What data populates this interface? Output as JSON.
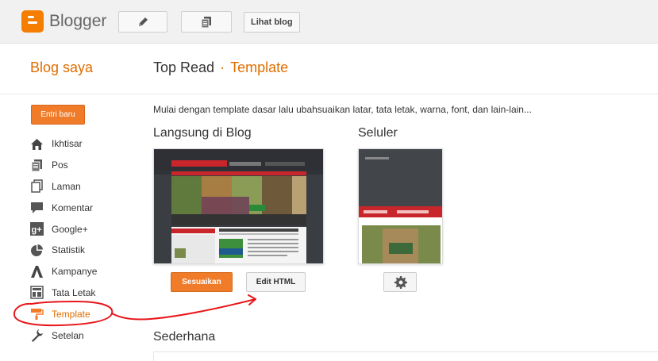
{
  "topbar": {
    "brand": "Blogger",
    "view_blog_label": "Lihat blog",
    "icons": [
      "pencil-icon",
      "posts-icon"
    ]
  },
  "header": {
    "left_title": "Blog saya",
    "blog_name": "Top Read",
    "separator": "·",
    "page": "Template"
  },
  "sidebar": {
    "new_post_label": "Entri baru",
    "items": [
      {
        "label": "Ikhtisar",
        "icon": "home-icon"
      },
      {
        "label": "Pos",
        "icon": "posts-icon"
      },
      {
        "label": "Laman",
        "icon": "pages-icon"
      },
      {
        "label": "Komentar",
        "icon": "comment-icon"
      },
      {
        "label": "Google+",
        "icon": "googleplus-icon"
      },
      {
        "label": "Statistik",
        "icon": "pie-chart-icon"
      },
      {
        "label": "Kampanye",
        "icon": "campaign-icon"
      },
      {
        "label": "Tata Letak",
        "icon": "layout-icon"
      },
      {
        "label": "Template",
        "icon": "paint-roller-icon",
        "active": true
      },
      {
        "label": "Setelan",
        "icon": "wrench-icon"
      }
    ]
  },
  "main": {
    "intro": "Mulai dengan template dasar lalu ubahsuaikan latar, tata letak, warna, font, dan lain-lain...",
    "live_title": "Langsung di Blog",
    "mobile_title": "Seluler",
    "customize_label": "Sesuaikan",
    "edit_html_label": "Edit HTML",
    "simple_title": "Sederhana"
  },
  "colors": {
    "accent": "#e06d00",
    "button_orange": "#f07c2a",
    "annotation_red": "#e8161b"
  }
}
